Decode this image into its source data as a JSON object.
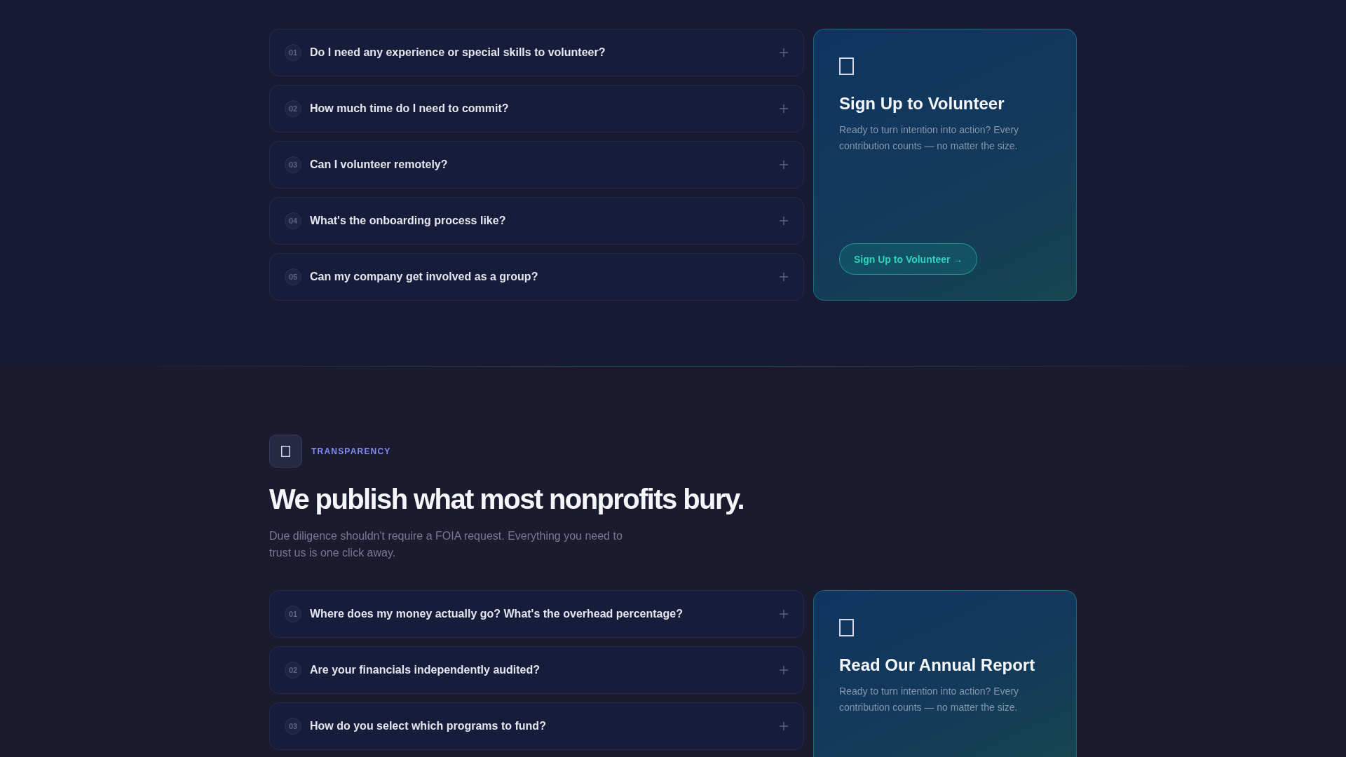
{
  "sections": [
    {
      "faqs": [
        {
          "number": "01",
          "question": "Do I need any experience or special skills to volunteer?",
          "expanded": false
        },
        {
          "number": "02",
          "question": "How much time do I need to commit?",
          "expanded": false
        },
        {
          "number": "03",
          "question": "Can I volunteer remotely?",
          "expanded": false
        },
        {
          "number": "04",
          "question": "What's the onboarding process like?",
          "expanded": false
        },
        {
          "number": "05",
          "question": "Can my company get involved as a group?",
          "expanded": false
        }
      ],
      "card": {
        "title": "Sign Up to Volunteer",
        "description": "Ready to turn intention into action? Every contribution counts — no matter the size.",
        "button": "Sign Up to Volunteer →"
      }
    },
    {
      "eyebrow": "TRANSPARENCY",
      "heading": "We publish what most nonprofits bury.",
      "intro": "Due diligence shouldn't require a FOIA request. Everything you need to trust us is one click away.",
      "faqs": [
        {
          "number": "01",
          "question": "Where does my money actually go? What's the overhead percentage?",
          "expanded": false
        },
        {
          "number": "02",
          "question": "Are your financials independently audited?",
          "expanded": false
        },
        {
          "number": "03",
          "question": "How do you select which programs to fund?",
          "expanded": false
        }
      ],
      "card": {
        "title": "Read Our Annual Report",
        "description": "Ready to turn intention into action? Every contribution counts — no matter the size."
      }
    }
  ]
}
